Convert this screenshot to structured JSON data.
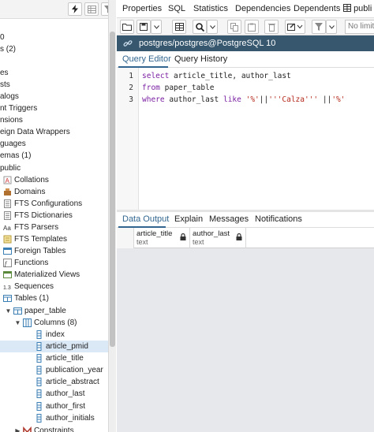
{
  "tree": {
    "items": [
      {
        "label": "0",
        "indent": 0
      },
      {
        "label": "s (2)",
        "indent": 0
      },
      {
        "label": "es",
        "indent": 0
      },
      {
        "label": "sts",
        "indent": 0
      },
      {
        "label": "alogs",
        "indent": 0
      },
      {
        "label": "nt Triggers",
        "indent": 0
      },
      {
        "label": "nsions",
        "indent": 0
      },
      {
        "label": "eign Data Wrappers",
        "indent": 0
      },
      {
        "label": "guages",
        "indent": 0
      },
      {
        "label": "emas (1)",
        "indent": 0
      },
      {
        "label": "public",
        "indent": 0
      },
      {
        "label": "Collations",
        "indent": 1
      },
      {
        "label": "Domains",
        "indent": 1
      },
      {
        "label": "FTS Configurations",
        "indent": 1
      },
      {
        "label": "FTS Dictionaries",
        "indent": 1
      },
      {
        "label": "FTS Parsers",
        "indent": 1
      },
      {
        "label": "FTS Templates",
        "indent": 1
      },
      {
        "label": "Foreign Tables",
        "indent": 1
      },
      {
        "label": "Functions",
        "indent": 1
      },
      {
        "label": "Materialized Views",
        "indent": 1
      },
      {
        "label": "Sequences",
        "indent": 1
      },
      {
        "label": "Tables (1)",
        "indent": 1
      },
      {
        "label": "paper_table",
        "indent": 2
      },
      {
        "label": "Columns (8)",
        "indent": 3
      },
      {
        "label": "index",
        "indent": 4
      },
      {
        "label": "article_pmid",
        "indent": 4
      },
      {
        "label": "article_title",
        "indent": 4
      },
      {
        "label": "publication_year",
        "indent": 4
      },
      {
        "label": "article_abstract",
        "indent": 4
      },
      {
        "label": "author_last",
        "indent": 4
      },
      {
        "label": "author_first",
        "indent": 4
      },
      {
        "label": "author_initials",
        "indent": 4
      },
      {
        "label": "Constraints",
        "indent": 3
      }
    ]
  },
  "main_tabs": [
    "Properties",
    "SQL",
    "Statistics",
    "Dependencies",
    "Dependents",
    "publi"
  ],
  "query_toolbar": {
    "limit_placeholder": "No limit"
  },
  "connection": {
    "label": "postgres/postgres@PostgreSQL 10"
  },
  "query_tabs": [
    "Query Editor",
    "Query History"
  ],
  "editor": {
    "line_numbers": [
      "1",
      "2",
      "3"
    ]
  },
  "output_tabs": [
    "Data Output",
    "Explain",
    "Messages",
    "Notifications"
  ],
  "grid": {
    "columns": [
      {
        "name": "article_title",
        "type": "text"
      },
      {
        "name": "author_last",
        "type": "text"
      }
    ]
  },
  "colors": {
    "accent": "#326690",
    "connection_bar": "#36576e",
    "keyword": "#7a1fa2",
    "string": "#b52a1d",
    "selected_row": "#dbe8f6",
    "grid_empty": "#e7e8ec"
  },
  "icons": {
    "left_toolbar": [
      "lightning-icon",
      "grid-view-icon",
      "filter-icon"
    ],
    "query_toolbar": [
      "open-folder-icon",
      "save-icon",
      "dropdown-icon",
      "find-icon",
      "copy-icon",
      "paste-icon",
      "delete-icon",
      "edit-icon",
      "filter-icon"
    ]
  }
}
